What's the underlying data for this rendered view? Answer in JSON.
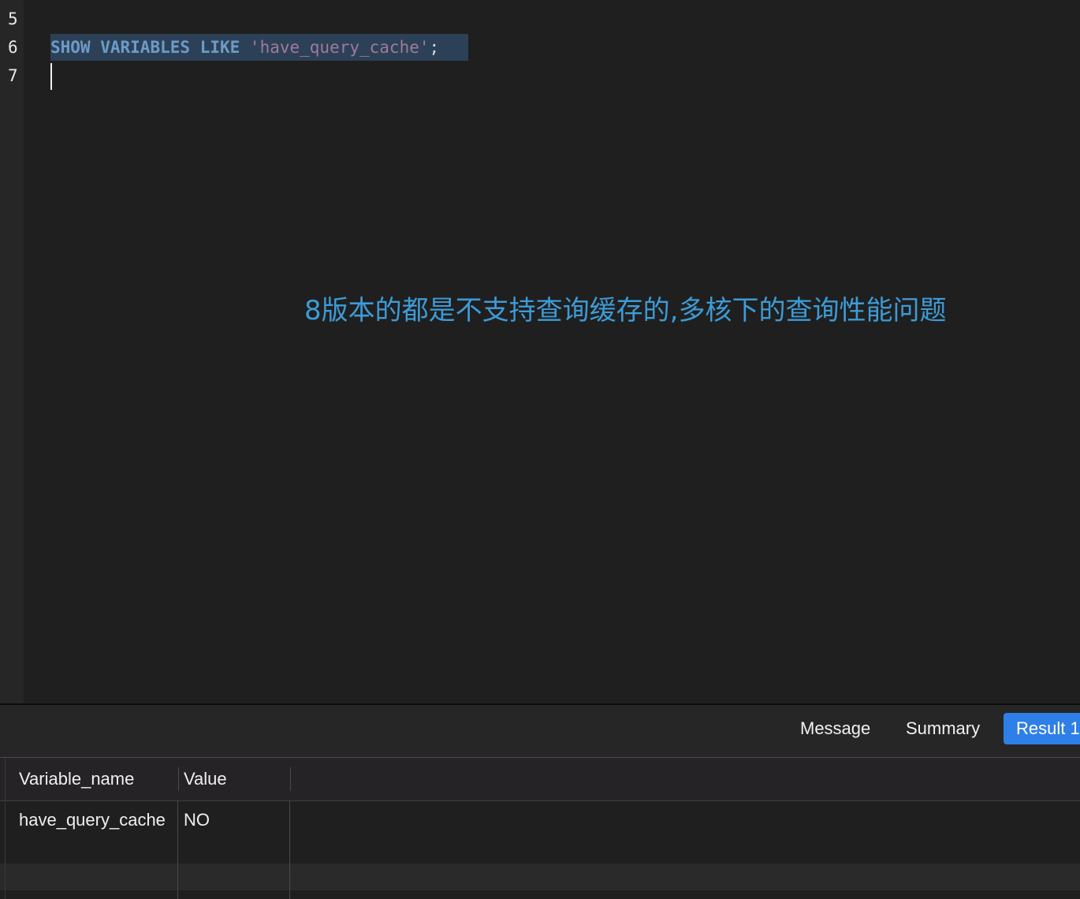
{
  "editor": {
    "line_numbers": [
      "5",
      "6",
      "7"
    ],
    "code": {
      "keyword1": "SHOW",
      "keyword2": "VARIABLES",
      "keyword3": "LIKE",
      "string": "'have_query_cache'",
      "terminator": ";"
    },
    "annotation": "8版本的都是不支持查询缓存的,多核下的查询性能问题"
  },
  "results": {
    "tabs": [
      {
        "label": "Message",
        "active": false
      },
      {
        "label": "Summary",
        "active": false
      },
      {
        "label": "Result 1",
        "active": true
      }
    ],
    "columns": [
      "Variable_name",
      "Value"
    ],
    "rows": [
      [
        "have_query_cache",
        "NO"
      ]
    ]
  },
  "colors": {
    "keyword": "#6d9bc8",
    "string": "#a07a9a",
    "annotation": "#3d9bd6",
    "active_tab": "#2f7fe8",
    "selection": "#2c4157"
  }
}
